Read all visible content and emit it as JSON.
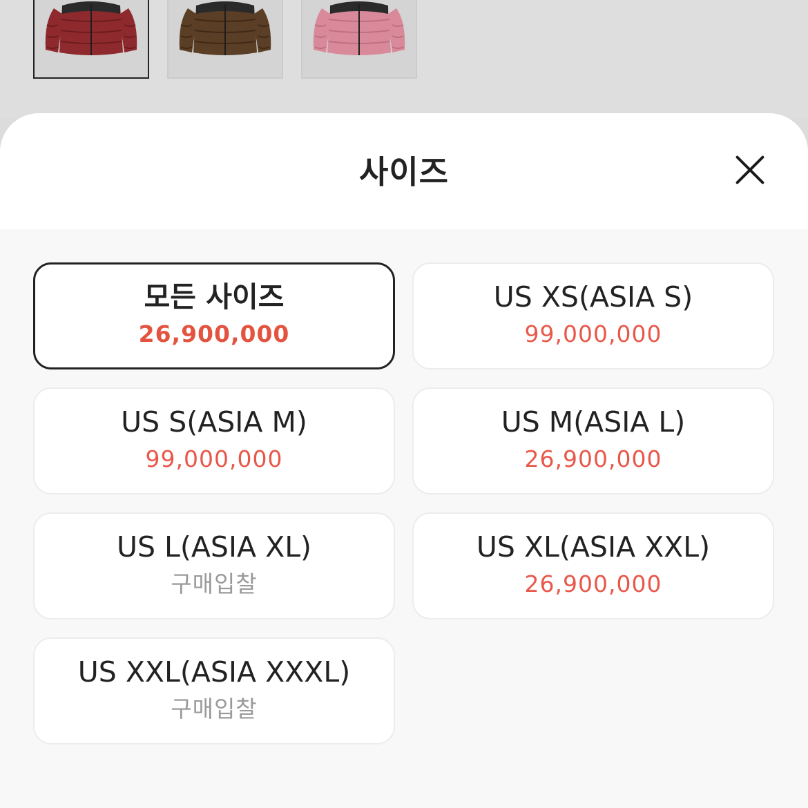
{
  "thumbnails": [
    {
      "color_name": "red",
      "body": "#8e2a2e",
      "shade": "#6e1c20",
      "selected": true
    },
    {
      "color_name": "brown",
      "body": "#5a3e25",
      "shade": "#402a17",
      "selected": false
    },
    {
      "color_name": "pink",
      "body": "#d98a9a",
      "shade": "#bf6f80",
      "selected": false
    }
  ],
  "sheet": {
    "title": "사이즈",
    "close_icon": "close-icon"
  },
  "options": [
    {
      "size": "모든 사이즈",
      "price": "26,900,000",
      "selected": true,
      "muted": false
    },
    {
      "size": "US XS(ASIA S)",
      "price": "99,000,000",
      "selected": false,
      "muted": false
    },
    {
      "size": "US S(ASIA M)",
      "price": "99,000,000",
      "selected": false,
      "muted": false
    },
    {
      "size": "US M(ASIA L)",
      "price": "26,900,000",
      "selected": false,
      "muted": false
    },
    {
      "size": "US L(ASIA XL)",
      "price": "구매입찰",
      "selected": false,
      "muted": true
    },
    {
      "size": "US XL(ASIA XXL)",
      "price": "26,900,000",
      "selected": false,
      "muted": false
    },
    {
      "size": "US XXL(ASIA XXXL)",
      "price": "구매입찰",
      "selected": false,
      "muted": true
    }
  ],
  "colors": {
    "price": "#e8584a",
    "muted": "#9a9a9a",
    "selected_border": "#222222"
  }
}
